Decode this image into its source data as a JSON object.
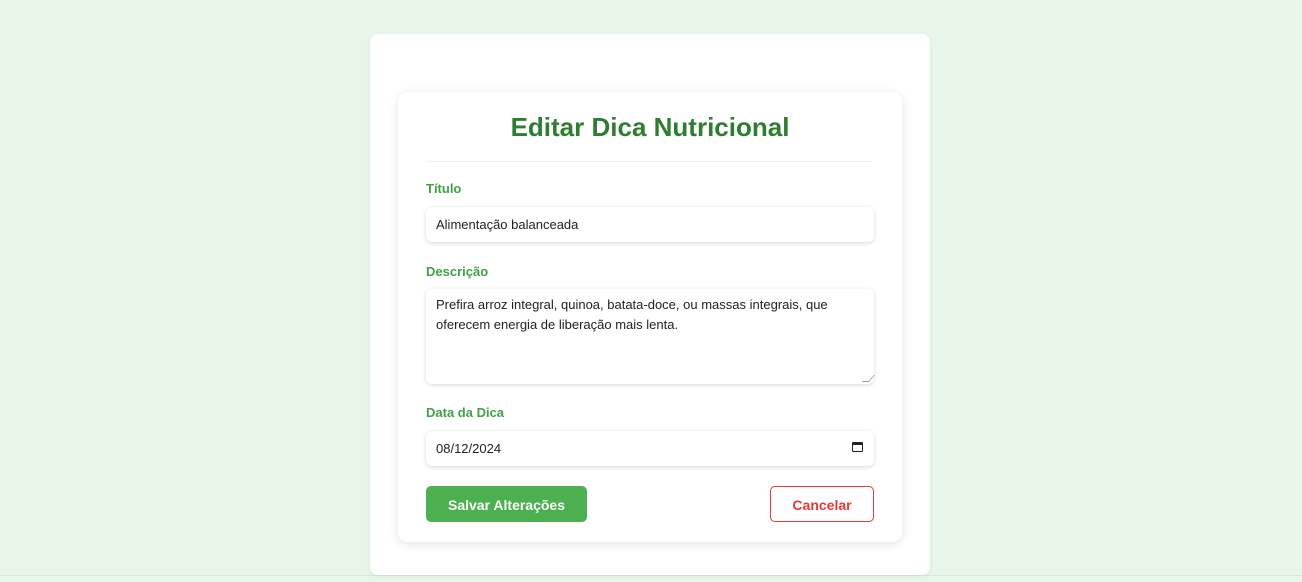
{
  "form": {
    "title": "Editar Dica Nutricional",
    "titulo_label": "Título",
    "titulo_value": "Alimentação balanceada",
    "descricao_label": "Descrição",
    "descricao_value": "Prefira arroz integral, quinoa, batata-doce, ou massas integrais, que oferecem energia de liberação mais lenta.",
    "data_label": "Data da Dica",
    "data_value": "08/12/2024",
    "save_label": "Salvar Alterações",
    "cancel_label": "Cancelar"
  },
  "icons": {
    "date_picker": "calendar-icon"
  },
  "colors": {
    "background": "#e8f5e9",
    "title": "#2e7d32",
    "label": "#43a047",
    "primary_button": "#4caf50",
    "cancel": "#e53935"
  }
}
